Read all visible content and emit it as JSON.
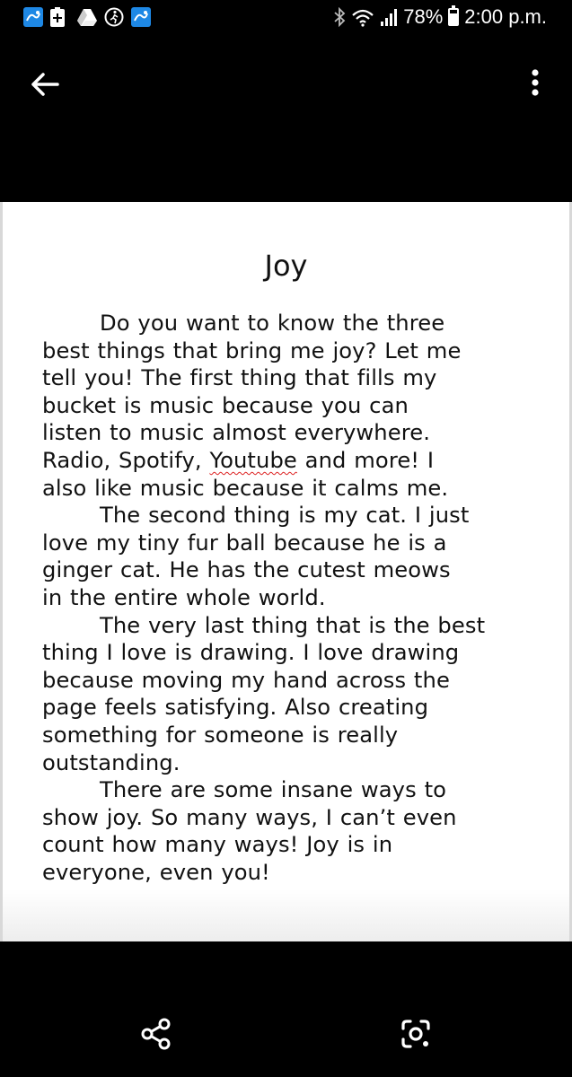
{
  "status_bar": {
    "battery": "78%",
    "time": "2:00 p.m.",
    "notification_icons": [
      "app-icon",
      "battery-saver-icon",
      "drive-icon",
      "fitness-icon",
      "app-icon"
    ]
  },
  "toolbar": {
    "back_icon": "arrow-left-icon",
    "menu_icon": "more-vert-icon"
  },
  "document": {
    "title": "Joy",
    "lines": [
      "Do you want to know the three",
      "best things that bring me joy?  Let me",
      "tell you!  The first thing that fills my",
      "bucket is music because you can",
      "listen to music almost everywhere.",
      "Radio, Spotify, ",
      "Youtube",
      " and more!  I",
      "also like music because it calms me.",
      "The second thing is my cat.  I just",
      "love my tiny fur ball because he is a",
      "ginger cat.  He has the cutest meows",
      "in the entire whole world.",
      "The very last thing that is the best",
      "thing I love is drawing.  I love drawing",
      "because moving my hand across the",
      "page feels satisfying.  Also creating",
      "something for someone is really",
      "outstanding.",
      "There are some insane ways to",
      "show joy.  So many ways, I can’t even",
      "count how many ways!  Joy is in",
      "everyone, even you!"
    ]
  },
  "bottom_bar": {
    "share_icon": "share-icon",
    "lens_icon": "lens-icon"
  },
  "colors": {
    "background": "#000000",
    "paper": "#ffffff",
    "text": "#111111",
    "spellcheck": "#dd2222",
    "notification_badge": "#1e88e5"
  }
}
